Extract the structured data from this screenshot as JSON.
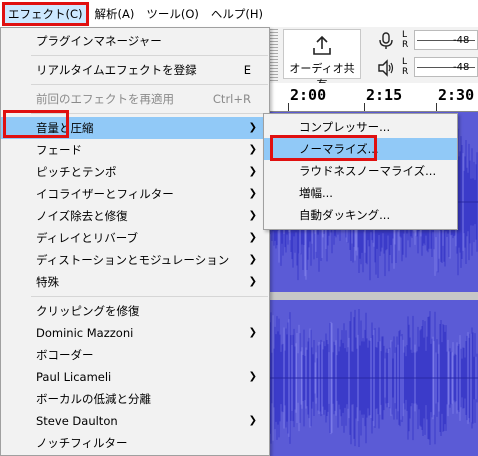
{
  "menubar": {
    "items": [
      "エフェクト(C)",
      "解析(A)",
      "ツール(O)",
      "ヘルプ(H)"
    ]
  },
  "effect_menu": {
    "items": [
      {
        "label": "プラグインマネージャー"
      },
      {
        "label": "リアルタイムエフェクトを登録",
        "accel": "E"
      },
      {
        "label": "前回のエフェクトを再適用",
        "accel": "Ctrl+R",
        "disabled": true
      },
      {
        "label": "音量と圧縮"
      },
      {
        "label": "フェード"
      },
      {
        "label": "ピッチとテンポ"
      },
      {
        "label": "イコライザーとフィルター"
      },
      {
        "label": "ノイズ除去と修復"
      },
      {
        "label": "ディレイとリバーブ"
      },
      {
        "label": "ディストーションとモジュレーション"
      },
      {
        "label": "特殊"
      },
      {
        "label": "クリッピングを修復"
      },
      {
        "label": "Dominic Mazzoni"
      },
      {
        "label": "ボコーダー"
      },
      {
        "label": "Paul Licameli"
      },
      {
        "label": "ボーカルの低減と分離"
      },
      {
        "label": "Steve Daulton"
      },
      {
        "label": "ノッチフィルター"
      }
    ]
  },
  "volume_submenu": {
    "items": [
      "コンプレッサー...",
      "ノーマライズ...",
      "ラウドネスノーマライズ...",
      "増幅...",
      "自動ダッキング..."
    ]
  },
  "toolbar": {
    "share_label": "オーディオ共有",
    "meter_db": "-48",
    "meter_l": "L",
    "meter_r": "R"
  },
  "ruler": {
    "times": [
      "2:00",
      "2:15",
      "2:30"
    ]
  },
  "colors": {
    "highlight": "#91c9f7",
    "annotation_red": "#e01010",
    "waveform": "#3b3bc9"
  }
}
